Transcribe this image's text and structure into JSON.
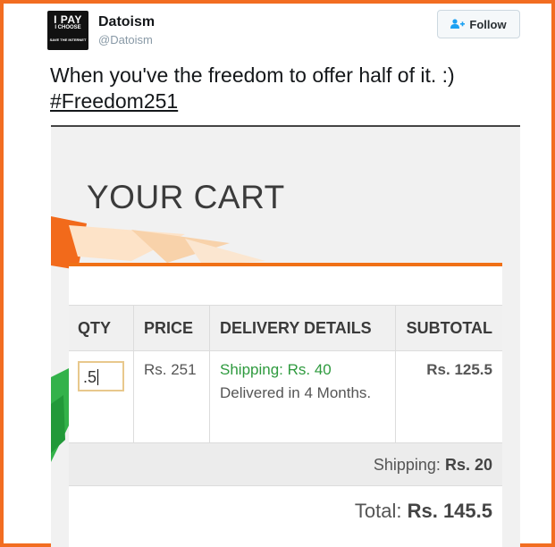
{
  "tweet": {
    "name": "Datoism",
    "handle": "@Datoism",
    "follow_label": "Follow",
    "avatar": {
      "line1": "I PAY",
      "line2": "I CHOOSE",
      "line3": "SAVE THE INTERNET"
    },
    "text": "When you've the freedom to offer half of it. :)",
    "hashtag": "#Freedom251"
  },
  "cart": {
    "title": "YOUR CART",
    "headers": {
      "qty": "QTY",
      "price": "PRICE",
      "delivery": "DELIVERY DETAILS",
      "subtotal": "SUBTOTAL"
    },
    "item": {
      "qty_value": ".5",
      "price": "Rs. 251",
      "shipping": "Shipping: Rs. 40",
      "delivery_note": "Delivered in 4 Months.",
      "subtotal": "Rs. 125.5"
    },
    "shipping_label": "Shipping:",
    "shipping_value": "Rs. 20",
    "total_label": "Total:",
    "total_value": "Rs. 145.5"
  },
  "colors": {
    "frame": "#f26d21",
    "accent": "#f07016",
    "green": "#2e9a3e",
    "follow_icon": "#1da1f2"
  },
  "icons": {
    "follow": "add-user-icon"
  }
}
